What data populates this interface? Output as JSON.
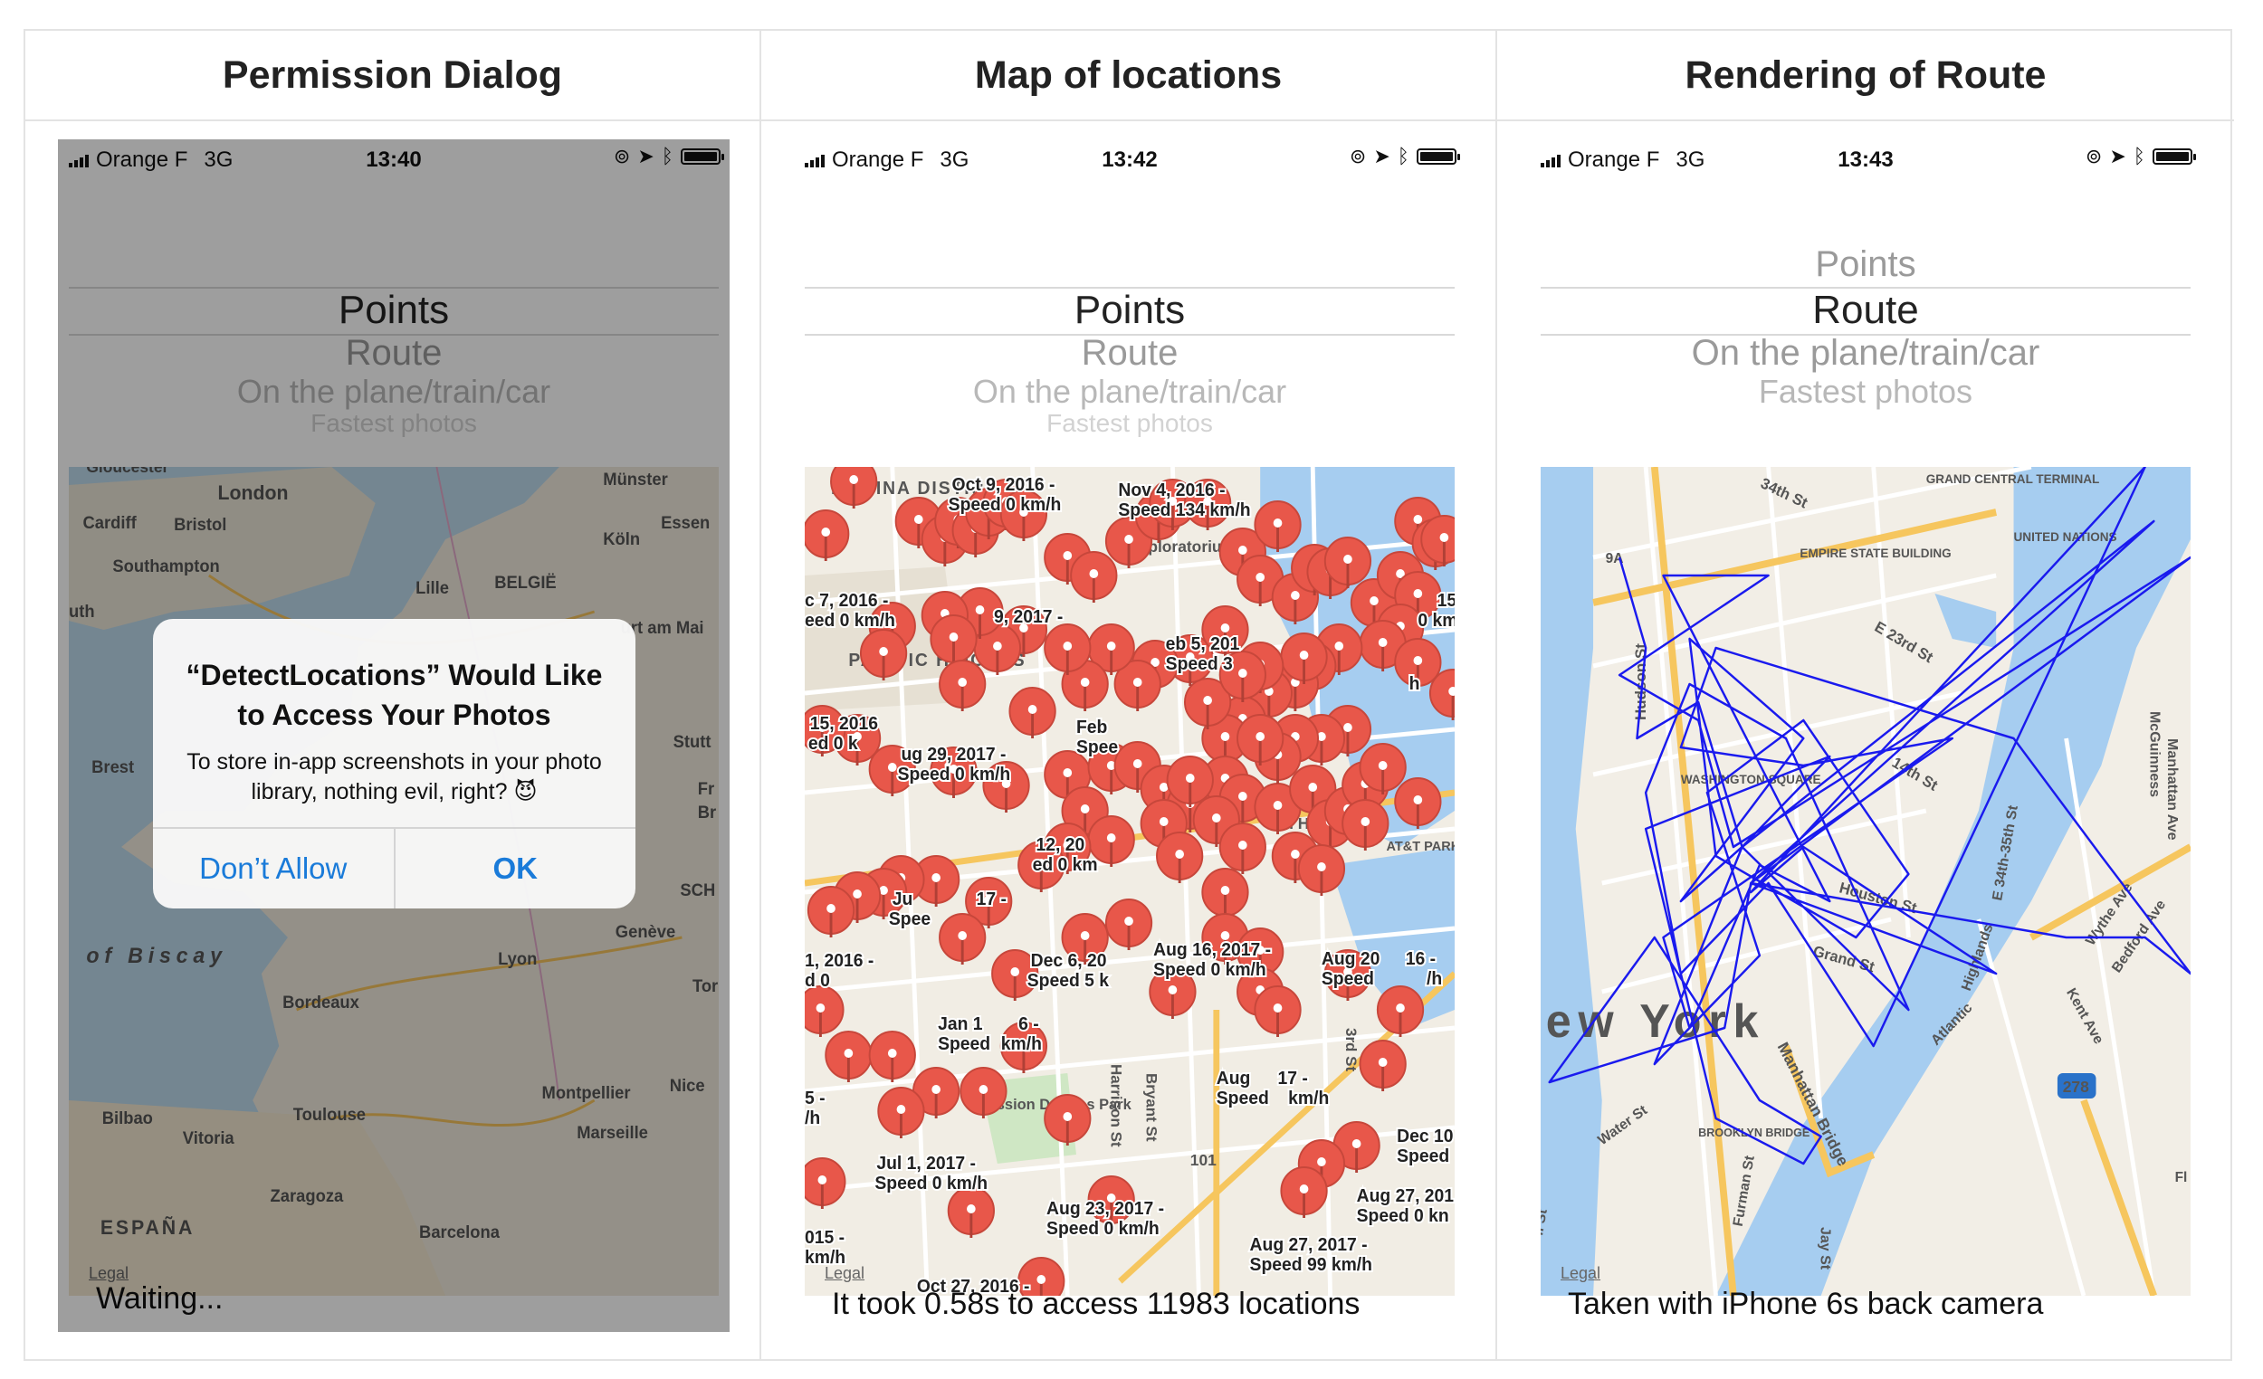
{
  "columns": [
    {
      "header": "Permission Dialog",
      "status": {
        "carrier": "Orange F",
        "network": "3G",
        "time": "13:40"
      },
      "picker": {
        "selected": "Points",
        "options_below": [
          "Route",
          "On the plane/train/car",
          "Fastest photos"
        ],
        "options_above": []
      },
      "map_labels": [
        "Gloucester",
        "London",
        "Cardiff",
        "Bristol",
        "Southampton",
        "Lille",
        "BELGIË",
        "Münster",
        "Essen",
        "Köln",
        "Brest",
        "Stutt",
        "of Biscay",
        "Genève",
        "Lyon",
        "Tor",
        "Bordeaux",
        "Nice",
        "Montpellier",
        "Toulouse",
        "Marseille",
        "Bilbao",
        "Vitoria",
        "Zaragoza",
        "ESPAÑA",
        "Barcelona",
        "uth",
        "urt am Mai",
        "Fr",
        "Br",
        "SCH"
      ],
      "alert": {
        "title": "“DetectLocations” Would Like to Access Your Photos",
        "message": "To store in-app screenshots in your photo library, nothing evil, right? 😈",
        "deny_label": "Don’t Allow",
        "ok_label": "OK"
      },
      "caption": "Waiting..."
    },
    {
      "header": "Map of locations",
      "status": {
        "carrier": "Orange F",
        "network": "3G",
        "time": "13:42"
      },
      "picker": {
        "selected": "Points",
        "options_below": [
          "Route",
          "On the plane/train/car",
          "Fastest photos"
        ],
        "options_above": []
      },
      "map_labels": [
        "MARINA DISTRICT",
        "PACIFIC HEIGHTS",
        "Exploratorium",
        "Mission Dolores Park",
        "Harrison St",
        "Bryant St",
        "3rd St",
        "101",
        "AT&T PARK",
        "TH BEACH"
      ],
      "pin_labels": [
        "Oct 9, 2016 -",
        "Speed 0 km/h",
        "Nov 4, 2016 -",
        "Speed 134 km/h",
        "c 7, 2016 -",
        "eed 0 km/h",
        "9, 2017 -",
        "eb 5, 201",
        "Speed 3",
        "15, 2016",
        "ed 0 k",
        "ug 29, 2017 -",
        "Speed 0 km/h",
        "Feb",
        "Spee",
        "12, 20",
        "ed 0 km",
        "Ju",
        "Spee",
        "17 -",
        "1, 2016 -",
        "d 0",
        "Dec 6, 20",
        "Speed 5 k",
        "Aug 16, 2017 -",
        "Speed 0 km/h",
        "Aug 20",
        "16 -",
        "Speed",
        "/h",
        "Jan 1",
        "6 -",
        "Speed",
        "km/h",
        "5 -",
        "/h",
        "Aug",
        "17 -",
        "Speed",
        "km/h",
        "Dec 10",
        "Speed",
        "Jul 1, 2017 -",
        "Speed 0 km/h",
        "Aug 23, 2017 -",
        "Speed 0 km/h",
        "Aug 27, 201",
        "Speed 0 kn",
        "015 -",
        "km/h",
        "Aug 27, 2017 -",
        "Speed 99 km/h",
        "Oct 27, 2016 -",
        "15",
        "0 km",
        "h"
      ],
      "caption": "It took 0.58s to access 11983 locations"
    },
    {
      "header": "Rendering of Route",
      "status": {
        "carrier": "Orange F",
        "network": "3G",
        "time": "13:43"
      },
      "picker": {
        "selected": "Route",
        "options_below": [
          "On the plane/train/car",
          "Fastest photos"
        ],
        "options_above": [
          "Points"
        ]
      },
      "map_labels": [
        "34th St",
        "GRAND CENTRAL TERMINAL",
        "UNITED NATIONS",
        "EMPIRE STATE BUILDING",
        "9A",
        "E 23rd St",
        "WASHINGTON SQUARE",
        "Hudson St",
        "14th St",
        "ew York",
        "Houston St",
        "Grand St",
        "Manhattan Bridge",
        "BROOKLYN BRIDGE",
        "Water St",
        "278",
        "Furman St",
        "McGuinness",
        "Manhattan Ave",
        "E 34th-35th St",
        "Highlands",
        "Atlantic",
        "Bedford Ave",
        "Wythe Ave",
        "Kent Ave",
        "Jay St",
        "Fl",
        "ll St"
      ],
      "caption": "Taken with iPhone 6s back camera"
    }
  ],
  "common": {
    "legal": "Legal"
  },
  "colors": {
    "pin": "#e8574a",
    "route": "#1a1aee",
    "alert_button": "#1a7bd9"
  }
}
